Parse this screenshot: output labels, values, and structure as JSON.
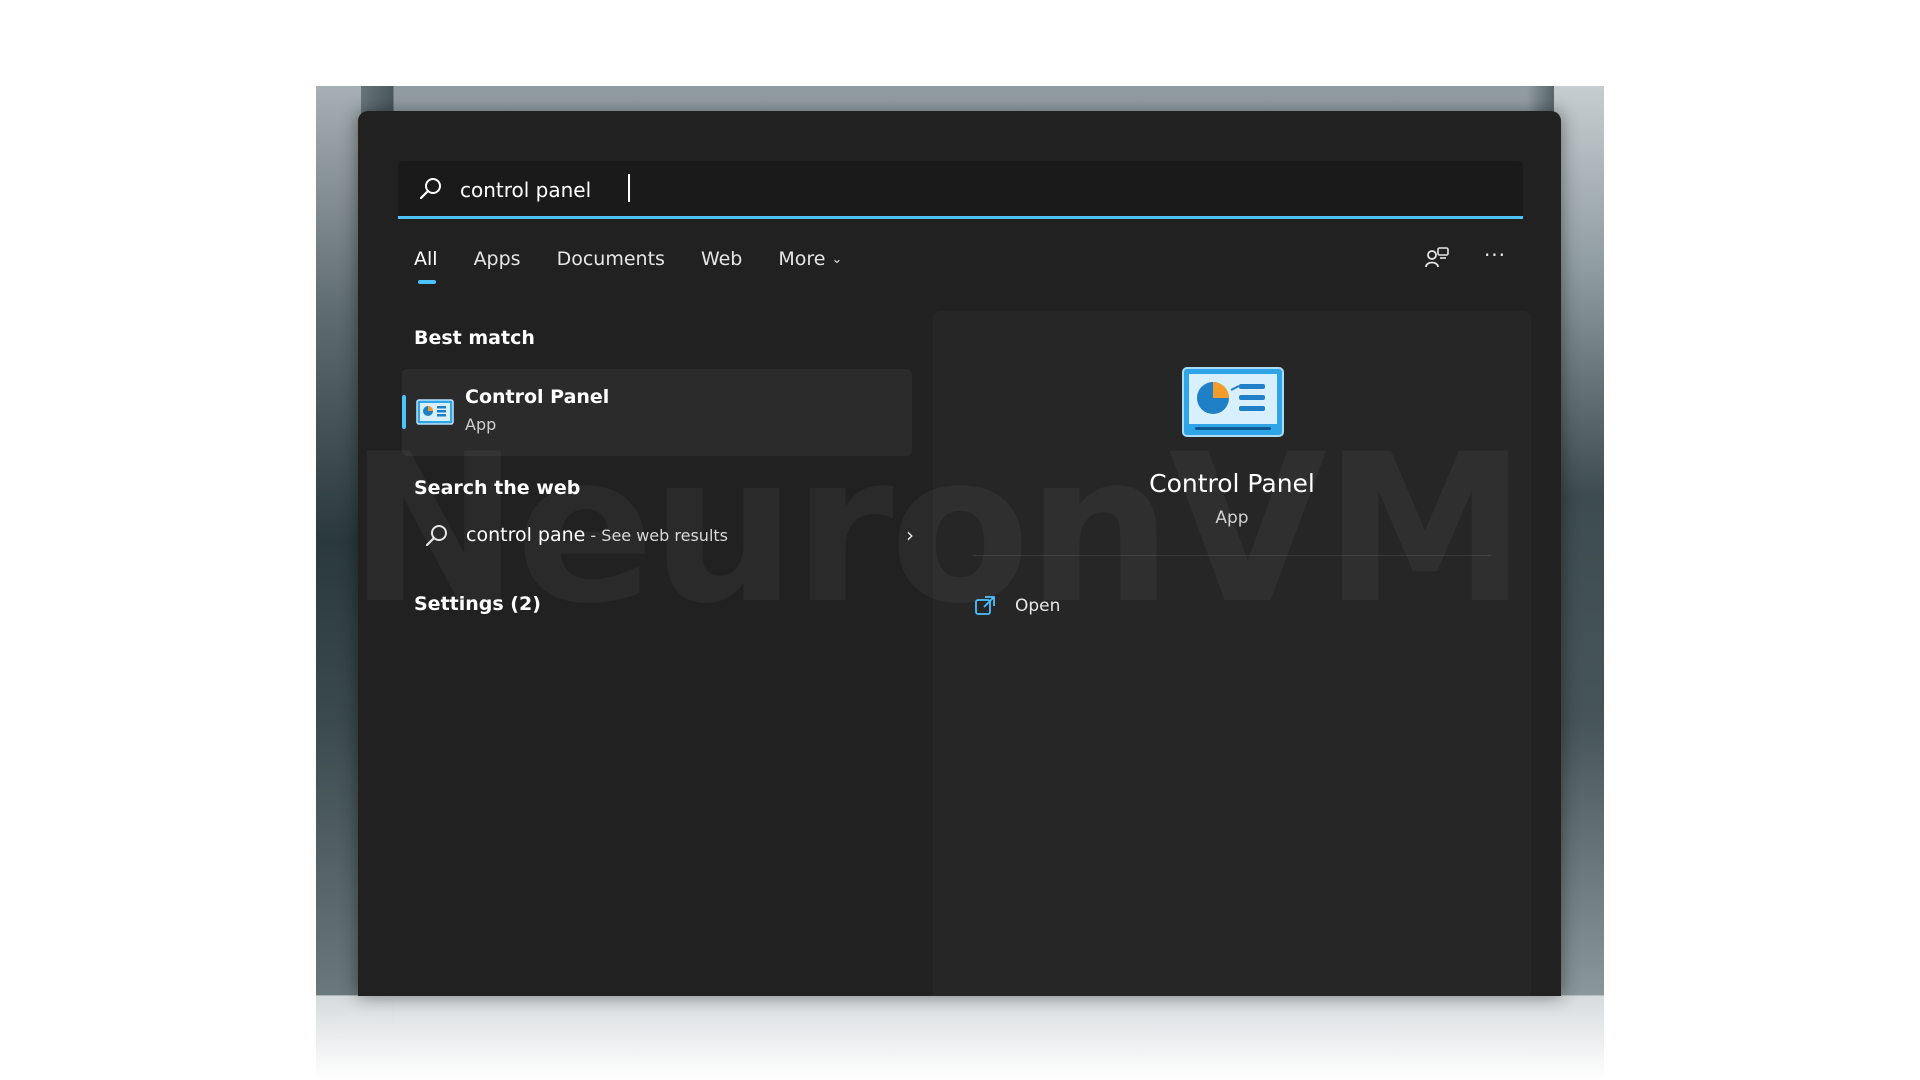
{
  "search": {
    "value": "control panel"
  },
  "tabs": [
    {
      "label": "All",
      "active": true
    },
    {
      "label": "Apps",
      "active": false
    },
    {
      "label": "Documents",
      "active": false
    },
    {
      "label": "Web",
      "active": false
    },
    {
      "label": "More",
      "active": false,
      "dropdown": true
    }
  ],
  "toolbar": {
    "share_icon": "feedback-icon",
    "more_label": "···"
  },
  "left": {
    "best_match_title": "Best match",
    "best_match": {
      "name": "Control Panel",
      "type": "App",
      "icon": "control-panel-icon"
    },
    "web_title": "Search the web",
    "web_result": {
      "query": "control pane",
      "suffix": " - See web results"
    },
    "settings_title": "Settings (2)"
  },
  "preview": {
    "name": "Control Panel",
    "type": "App",
    "action_open": "Open"
  },
  "watermark": "NeuronVM",
  "colors": {
    "accent": "#4cc2ff",
    "window_bg": "#212121",
    "preview_bg": "#262626"
  }
}
